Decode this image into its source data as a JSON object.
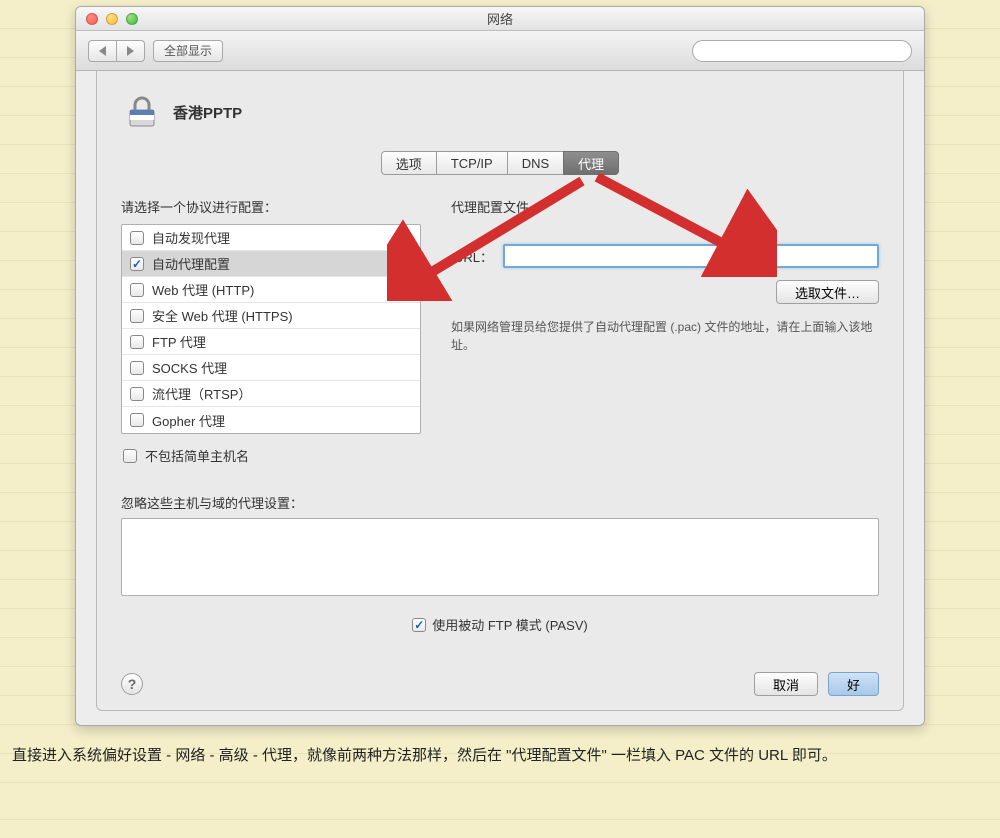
{
  "window": {
    "title": "网络"
  },
  "toolbar": {
    "show_all": "全部显示",
    "search_placeholder": ""
  },
  "connection": {
    "name": "香港PPTP"
  },
  "tabs": {
    "options": "选项",
    "tcpip": "TCP/IP",
    "dns": "DNS",
    "proxy": "代理"
  },
  "left": {
    "label": "请选择一个协议进行配置：",
    "protocols": [
      {
        "label": "自动发现代理",
        "checked": false
      },
      {
        "label": "自动代理配置",
        "checked": true
      },
      {
        "label": "Web 代理 (HTTP)",
        "checked": false
      },
      {
        "label": "安全 Web 代理 (HTTPS)",
        "checked": false
      },
      {
        "label": "FTP 代理",
        "checked": false
      },
      {
        "label": "SOCKS 代理",
        "checked": false
      },
      {
        "label": "流代理（RTSP）",
        "checked": false
      },
      {
        "label": "Gopher 代理",
        "checked": false
      }
    ],
    "exclude_simple": "不包括简单主机名"
  },
  "right": {
    "header": "代理配置文件",
    "url_label": "URL：",
    "url_value": "",
    "choose_file": "选取文件…",
    "help_text": "如果网络管理员给您提供了自动代理配置 (.pac) 文件的地址，请在上面输入该地址。"
  },
  "exclude": {
    "label": "忽略这些主机与域的代理设置：",
    "value": ""
  },
  "pasv": {
    "label": "使用被动 FTP 模式 (PASV)"
  },
  "buttons": {
    "cancel": "取消",
    "ok": "好"
  },
  "caption": "直接进入系统偏好设置 - 网络 - 高级 - 代理，就像前两种方法那样，然后在 \"代理配置文件\" 一栏填入 PAC 文件的 URL 即可。"
}
